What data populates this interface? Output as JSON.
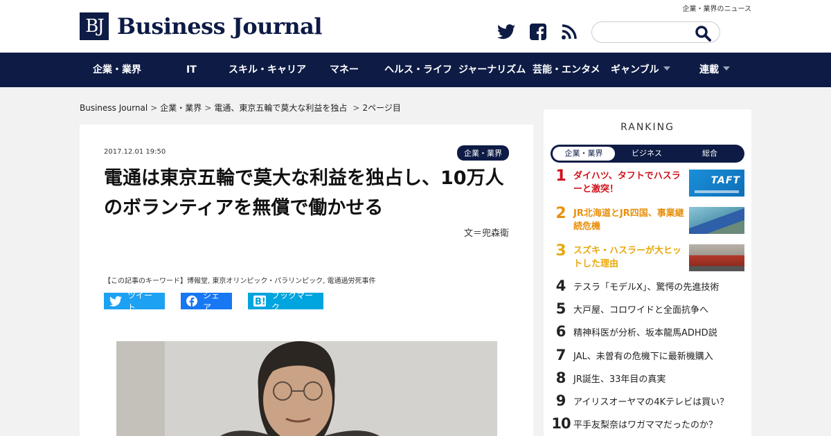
{
  "header": {
    "tagline": "企業・業界のニュース",
    "logo_mark": "BJ",
    "logo_text": "Business Journal",
    "search_placeholder": ""
  },
  "icons": {
    "twitter": "twitter-icon",
    "facebook": "facebook-icon",
    "rss": "rss-icon",
    "search": "search-icon"
  },
  "nav": {
    "items": [
      {
        "label": "企業・業界"
      },
      {
        "label": "IT"
      },
      {
        "label": "スキル・キャリア"
      },
      {
        "label": "マネー"
      },
      {
        "label": "ヘルス・ライフ"
      },
      {
        "label": "ジャーナリズム"
      },
      {
        "label": "芸能・エンタメ"
      },
      {
        "label": "ギャンブル"
      },
      {
        "label": "連載"
      }
    ]
  },
  "breadcrumb": {
    "items": [
      "Business Journal",
      "企業・業界",
      "電通、東京五輪で莫大な利益を独占"
    ],
    "current": "2ページ目"
  },
  "article": {
    "date": "2017.12.01 19:50",
    "category": "企業・業界",
    "title": "電通は東京五輪で莫大な利益を独占し、10万人のボランティアを無償で働かせる",
    "author": "文＝兜森衛",
    "keywords": "【この記事のキーワード】博報堂, 東京オリンピック・パラリンピック, 電通過労死事件",
    "share": {
      "tweet": "ツイート",
      "share": "シェア",
      "bookmark": "ブックマーク"
    }
  },
  "ranking": {
    "title": "RANKING",
    "tabs": [
      "企業・業界",
      "ビジネス",
      "総合"
    ],
    "items": [
      {
        "rank": "1",
        "text": "ダイハツ、タフトでハスラーと激突！"
      },
      {
        "rank": "2",
        "text": "JR北海道とJR四国、事業継続危機"
      },
      {
        "rank": "3",
        "text": "スズキ・ハスラーが大ヒットした理由"
      },
      {
        "rank": "4",
        "text": "テスラ「モデルX」、驚愕の先進技術"
      },
      {
        "rank": "5",
        "text": "大戸屋、コロワイドと全面抗争へ"
      },
      {
        "rank": "6",
        "text": "精神科医が分析、坂本龍馬ADHD説"
      },
      {
        "rank": "7",
        "text": "JAL、未曽有の危機下に最新機購入"
      },
      {
        "rank": "8",
        "text": "JR誕生、33年目の真実"
      },
      {
        "rank": "9",
        "text": "アイリスオーヤマの4Kテレビは買い？"
      },
      {
        "rank": "10",
        "text": "平手友梨奈はワガママだったのか？"
      }
    ],
    "thumb1_text": "TAFT",
    "colors": {
      "rank1": "#d0121b",
      "rank2": "#e8900c",
      "rank3": "#e8a80c",
      "default": "#222222"
    }
  },
  "colors": {
    "brand": "#0d1b45",
    "twitter": "#1da1f2",
    "facebook": "#1877f2",
    "hatena": "#00a4de"
  }
}
